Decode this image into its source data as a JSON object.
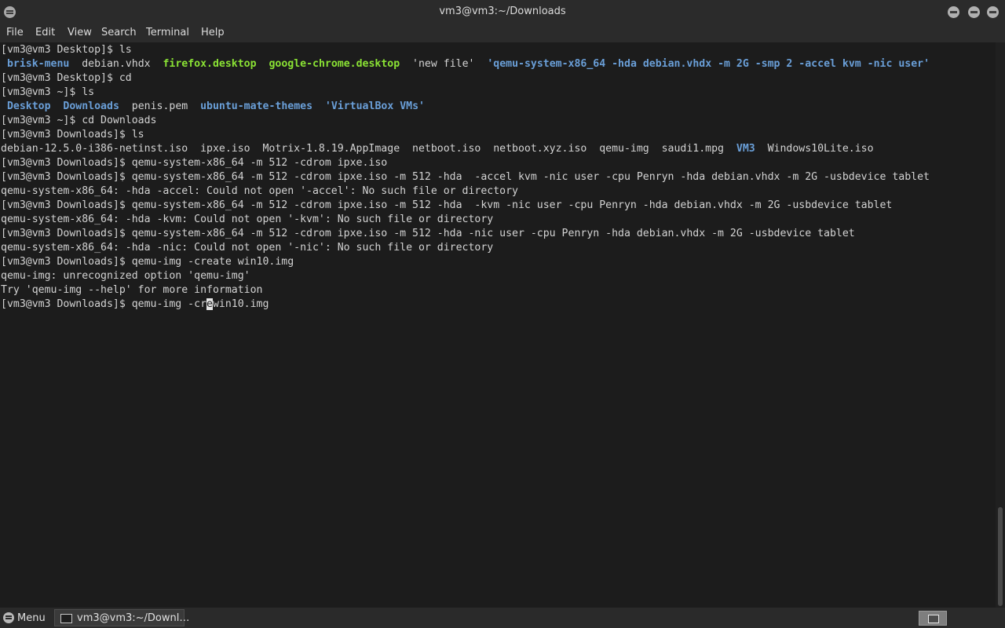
{
  "window": {
    "title": "vm3@vm3:~/Downloads",
    "icon": "mate-terminal-icon",
    "controls": [
      "minimize-button",
      "maximize-button",
      "close-button"
    ]
  },
  "menubar": {
    "items": [
      "File",
      "Edit",
      "View",
      "Search",
      "Terminal",
      "Help"
    ]
  },
  "colors": {
    "background": "#1c1c1c",
    "text": "#d3d3d3",
    "directory": "#6a9fd8",
    "executable": "#8ae234",
    "chrome": "#2b2b2b"
  },
  "terminal": {
    "cursor_char": "e",
    "lines": [
      [
        {
          "t": "[vm3@vm3 Desktop]$ ls"
        }
      ],
      [
        {
          "t": " "
        },
        {
          "t": "brisk-menu",
          "c": "dir"
        },
        {
          "t": "  debian.vhdx  "
        },
        {
          "t": "firefox.desktop",
          "c": "exe"
        },
        {
          "t": "  "
        },
        {
          "t": "google-chrome.desktop",
          "c": "exe"
        },
        {
          "t": "  'new file'  "
        },
        {
          "t": "'qemu-system-x86_64 -hda debian.vhdx -m 2G -smp 2 -accel kvm -nic user'",
          "c": "dir"
        }
      ],
      [
        {
          "t": "[vm3@vm3 Desktop]$ cd"
        }
      ],
      [
        {
          "t": "[vm3@vm3 ~]$ ls"
        }
      ],
      [
        {
          "t": " "
        },
        {
          "t": "Desktop",
          "c": "dir"
        },
        {
          "t": "  "
        },
        {
          "t": "Downloads",
          "c": "dir"
        },
        {
          "t": "  penis.pem  "
        },
        {
          "t": "ubuntu-mate-themes",
          "c": "dir"
        },
        {
          "t": "  "
        },
        {
          "t": "'VirtualBox VMs'",
          "c": "dir"
        }
      ],
      [
        {
          "t": "[vm3@vm3 ~]$ cd Downloads"
        }
      ],
      [
        {
          "t": "[vm3@vm3 Downloads]$ ls"
        }
      ],
      [
        {
          "t": "debian-12.5.0-i386-netinst.iso  ipxe.iso  Motrix-1.8.19.AppImage  netboot.iso  netboot.xyz.iso  qemu-img  saudi1.mpg  "
        },
        {
          "t": "VM3",
          "c": "dir"
        },
        {
          "t": "  Windows10Lite.iso"
        }
      ],
      [
        {
          "t": "[vm3@vm3 Downloads]$ qemu-system-x86_64 -m 512 -cdrom ipxe.iso"
        }
      ],
      [
        {
          "t": "[vm3@vm3 Downloads]$ qemu-system-x86_64 -m 512 -cdrom ipxe.iso -m 512 -hda  -accel kvm -nic user -cpu Penryn -hda debian.vhdx -m 2G -usbdevice tablet"
        }
      ],
      [
        {
          "t": "qemu-system-x86_64: -hda -accel: Could not open '-accel': No such file or directory"
        }
      ],
      [
        {
          "t": "[vm3@vm3 Downloads]$ qemu-system-x86_64 -m 512 -cdrom ipxe.iso -m 512 -hda  -kvm -nic user -cpu Penryn -hda debian.vhdx -m 2G -usbdevice tablet"
        }
      ],
      [
        {
          "t": "qemu-system-x86_64: -hda -kvm: Could not open '-kvm': No such file or directory"
        }
      ],
      [
        {
          "t": "[vm3@vm3 Downloads]$ qemu-system-x86_64 -m 512 -cdrom ipxe.iso -m 512 -hda -nic user -cpu Penryn -hda debian.vhdx -m 2G -usbdevice tablet"
        }
      ],
      [
        {
          "t": "qemu-system-x86_64: -hda -nic: Could not open '-nic': No such file or directory"
        }
      ],
      [
        {
          "t": "[vm3@vm3 Downloads]$ qemu-img -create win10.img"
        }
      ],
      [
        {
          "t": "qemu-img: unrecognized option 'qemu-img'"
        }
      ],
      [
        {
          "t": "Try 'qemu-img --help' for more information"
        }
      ],
      [
        {
          "t": "[vm3@vm3 Downloads]$ qemu-img -cr"
        },
        {
          "t": "e",
          "c": "cursor"
        },
        {
          "t": "win10.img"
        }
      ]
    ]
  },
  "taskbar": {
    "menu_label": "Menu",
    "task_label": "vm3@vm3:~/Downl…",
    "task_icon": "terminal-window-icon",
    "workspace_icon": "workspace-switcher-icon"
  }
}
